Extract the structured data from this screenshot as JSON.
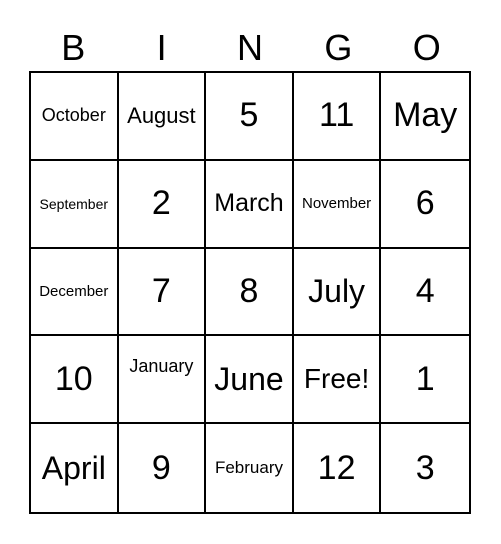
{
  "header": [
    "B",
    "I",
    "N",
    "G",
    "O"
  ],
  "cells": [
    [
      "October",
      "August",
      "5",
      "11",
      "May"
    ],
    [
      "September",
      "2",
      "March",
      "November",
      "6"
    ],
    [
      "December",
      "7",
      "8",
      "July",
      "4"
    ],
    [
      "10",
      "January",
      "June",
      "Free!",
      "1"
    ],
    [
      "April",
      "9",
      "February",
      "12",
      "3"
    ]
  ]
}
